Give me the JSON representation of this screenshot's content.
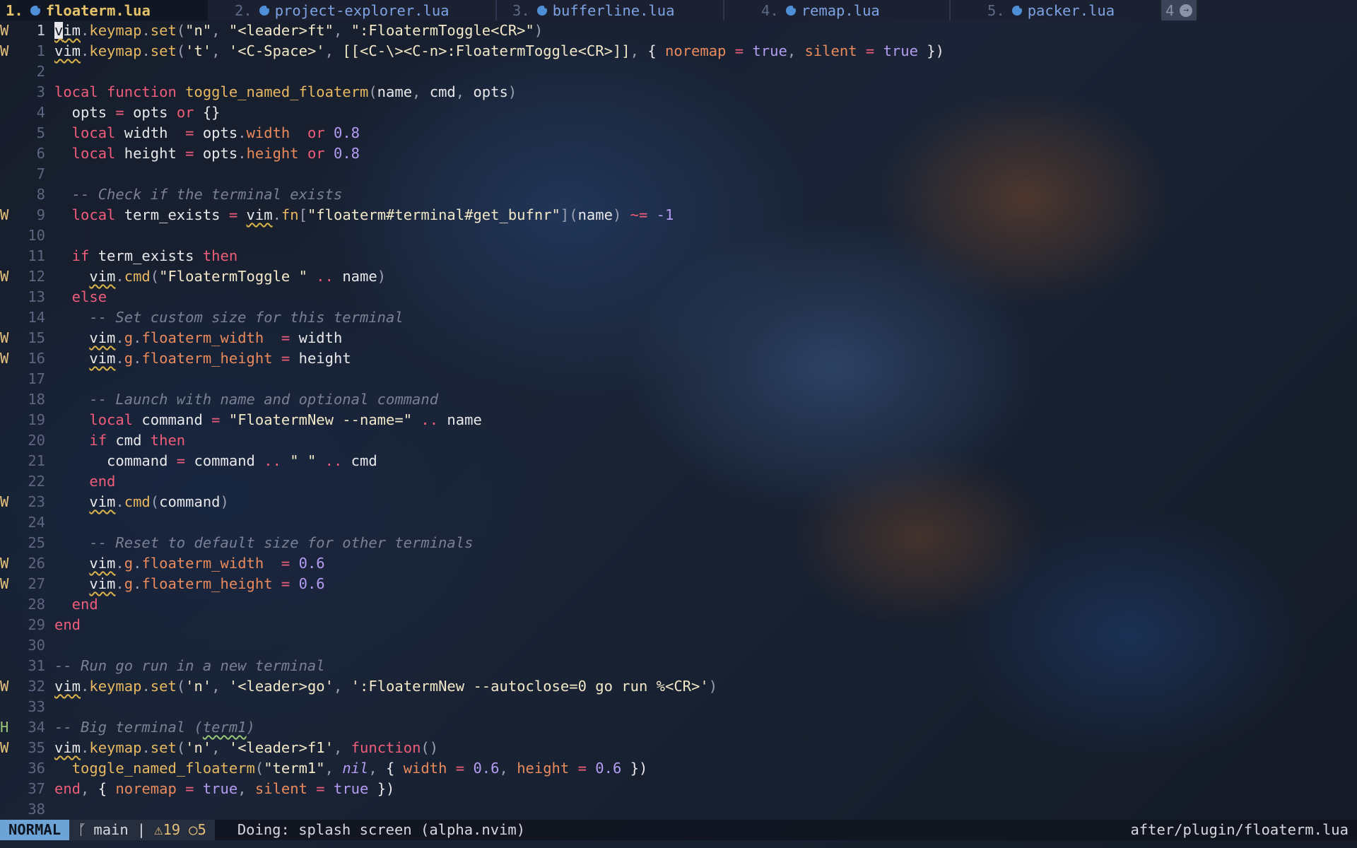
{
  "tabs": [
    {
      "num": "1.",
      "name": "floaterm.lua",
      "active": true
    },
    {
      "num": "2.",
      "name": "project-explorer.lua"
    },
    {
      "num": "3.",
      "name": "bufferline.lua"
    },
    {
      "num": "4.",
      "name": "remap.lua"
    },
    {
      "num": "5.",
      "name": "packer.lua"
    }
  ],
  "tab_overflow": "4",
  "editor": {
    "lines": [
      {
        "sign": "W",
        "nr": "1",
        "cur": true
      },
      {
        "sign": "W",
        "nr": "1"
      },
      {
        "sign": "",
        "nr": "2"
      },
      {
        "sign": "",
        "nr": "3"
      },
      {
        "sign": "",
        "nr": "4"
      },
      {
        "sign": "",
        "nr": "5"
      },
      {
        "sign": "",
        "nr": "6"
      },
      {
        "sign": "",
        "nr": "7"
      },
      {
        "sign": "",
        "nr": "8"
      },
      {
        "sign": "W",
        "nr": "9"
      },
      {
        "sign": "",
        "nr": "10"
      },
      {
        "sign": "",
        "nr": "11"
      },
      {
        "sign": "W",
        "nr": "12"
      },
      {
        "sign": "",
        "nr": "13"
      },
      {
        "sign": "",
        "nr": "14"
      },
      {
        "sign": "W",
        "nr": "15"
      },
      {
        "sign": "W",
        "nr": "16"
      },
      {
        "sign": "",
        "nr": "17"
      },
      {
        "sign": "",
        "nr": "18"
      },
      {
        "sign": "",
        "nr": "19"
      },
      {
        "sign": "",
        "nr": "20"
      },
      {
        "sign": "",
        "nr": "21"
      },
      {
        "sign": "",
        "nr": "22"
      },
      {
        "sign": "W",
        "nr": "23"
      },
      {
        "sign": "",
        "nr": "24"
      },
      {
        "sign": "",
        "nr": "25"
      },
      {
        "sign": "W",
        "nr": "26"
      },
      {
        "sign": "W",
        "nr": "27"
      },
      {
        "sign": "",
        "nr": "28"
      },
      {
        "sign": "",
        "nr": "29"
      },
      {
        "sign": "",
        "nr": "30"
      },
      {
        "sign": "",
        "nr": "31"
      },
      {
        "sign": "W",
        "nr": "32"
      },
      {
        "sign": "",
        "nr": "33"
      },
      {
        "sign": "H",
        "nr": "34"
      },
      {
        "sign": "W",
        "nr": "35"
      },
      {
        "sign": "",
        "nr": "36"
      },
      {
        "sign": "",
        "nr": "37"
      },
      {
        "sign": "",
        "nr": "38"
      }
    ],
    "code": [
      [
        [
          "vim",
          "v",
          1
        ],
        [
          "vim",
          "im"
        ],
        [
          "p",
          "."
        ],
        [
          "fn",
          "keymap"
        ],
        [
          "p",
          "."
        ],
        [
          "fn",
          "set"
        ],
        [
          "p",
          "("
        ],
        [
          "str",
          "\"n\""
        ],
        [
          "p",
          ", "
        ],
        [
          "str",
          "\"<leader>ft\""
        ],
        [
          "p",
          ", "
        ],
        [
          "str",
          "\":FloatermToggle<CR>\""
        ],
        [
          "p",
          ")"
        ]
      ],
      [
        [
          "vim",
          "vim"
        ],
        [
          "p",
          "."
        ],
        [
          "fn",
          "keymap"
        ],
        [
          "p",
          "."
        ],
        [
          "fn",
          "set"
        ],
        [
          "p",
          "("
        ],
        [
          "str",
          "'t'"
        ],
        [
          "p",
          ", "
        ],
        [
          "str",
          "'<C-Space>'"
        ],
        [
          "p",
          ", "
        ],
        [
          "str",
          "[[<C-\\><C-n>:FloatermToggle<CR>]]"
        ],
        [
          "p",
          ", "
        ],
        [
          "var",
          "{ "
        ],
        [
          "prop",
          "noremap"
        ],
        [
          "op",
          " = "
        ],
        [
          "bool",
          "true"
        ],
        [
          "p",
          ", "
        ],
        [
          "prop",
          "silent"
        ],
        [
          "op",
          " = "
        ],
        [
          "bool",
          "true"
        ],
        [
          "var",
          " })"
        ]
      ],
      [],
      [
        [
          "kw",
          "local function "
        ],
        [
          "fn",
          "toggle_named_floaterm"
        ],
        [
          "p",
          "("
        ],
        [
          "var",
          "name"
        ],
        [
          "p",
          ", "
        ],
        [
          "var",
          "cmd"
        ],
        [
          "p",
          ", "
        ],
        [
          "var",
          "opts"
        ],
        [
          "p",
          ")"
        ]
      ],
      [
        [
          "var",
          "  opts "
        ],
        [
          "op",
          "= "
        ],
        [
          "var",
          "opts "
        ],
        [
          "kw",
          "or "
        ],
        [
          "var",
          "{}"
        ]
      ],
      [
        [
          "kw",
          "  local "
        ],
        [
          "var",
          "width  "
        ],
        [
          "op",
          "= "
        ],
        [
          "var",
          "opts"
        ],
        [
          "p",
          "."
        ],
        [
          "prop",
          "width"
        ],
        [
          "var",
          "  "
        ],
        [
          "kw",
          "or "
        ],
        [
          "num",
          "0.8"
        ]
      ],
      [
        [
          "kw",
          "  local "
        ],
        [
          "var",
          "height "
        ],
        [
          "op",
          "= "
        ],
        [
          "var",
          "opts"
        ],
        [
          "p",
          "."
        ],
        [
          "prop",
          "height"
        ],
        [
          "var",
          " "
        ],
        [
          "kw",
          "or "
        ],
        [
          "num",
          "0.8"
        ]
      ],
      [],
      [
        [
          "cmt",
          "  -- Check if the terminal exists"
        ]
      ],
      [
        [
          "kw",
          "  local "
        ],
        [
          "var",
          "term_exists "
        ],
        [
          "op",
          "= "
        ],
        [
          "vim",
          "vim"
        ],
        [
          "p",
          "."
        ],
        [
          "fn",
          "fn"
        ],
        [
          "p",
          "["
        ],
        [
          "str",
          "\"floaterm#terminal#get_bufnr\""
        ],
        [
          "p",
          "]("
        ],
        [
          "var",
          "name"
        ],
        [
          "p",
          ") "
        ],
        [
          "op",
          "~= "
        ],
        [
          "num",
          "-1"
        ]
      ],
      [],
      [
        [
          "kw",
          "  if "
        ],
        [
          "var",
          "term_exists "
        ],
        [
          "kw",
          "then"
        ]
      ],
      [
        [
          "var",
          "    "
        ],
        [
          "vim",
          "vim"
        ],
        [
          "p",
          "."
        ],
        [
          "fn",
          "cmd"
        ],
        [
          "p",
          "("
        ],
        [
          "str",
          "\"FloatermToggle \""
        ],
        [
          "op",
          " .. "
        ],
        [
          "var",
          "name"
        ],
        [
          "p",
          ")"
        ]
      ],
      [
        [
          "kw",
          "  else"
        ]
      ],
      [
        [
          "cmt",
          "    -- Set custom size for this terminal"
        ]
      ],
      [
        [
          "var",
          "    "
        ],
        [
          "vim",
          "vim"
        ],
        [
          "p",
          "."
        ],
        [
          "prop",
          "g"
        ],
        [
          "p",
          "."
        ],
        [
          "prop",
          "floaterm_width"
        ],
        [
          "op",
          "  = "
        ],
        [
          "var",
          "width"
        ]
      ],
      [
        [
          "var",
          "    "
        ],
        [
          "vim",
          "vim"
        ],
        [
          "p",
          "."
        ],
        [
          "prop",
          "g"
        ],
        [
          "p",
          "."
        ],
        [
          "prop",
          "floaterm_height"
        ],
        [
          "op",
          " = "
        ],
        [
          "var",
          "height"
        ]
      ],
      [],
      [
        [
          "cmt",
          "    -- Launch with name and optional command"
        ]
      ],
      [
        [
          "kw",
          "    local "
        ],
        [
          "var",
          "command "
        ],
        [
          "op",
          "= "
        ],
        [
          "str",
          "\"FloatermNew --name=\""
        ],
        [
          "op",
          " .. "
        ],
        [
          "var",
          "name"
        ]
      ],
      [
        [
          "kw",
          "    if "
        ],
        [
          "var",
          "cmd "
        ],
        [
          "kw",
          "then"
        ]
      ],
      [
        [
          "var",
          "      command "
        ],
        [
          "op",
          "= "
        ],
        [
          "var",
          "command "
        ],
        [
          "op",
          ".. "
        ],
        [
          "str",
          "\" \""
        ],
        [
          "op",
          " .. "
        ],
        [
          "var",
          "cmd"
        ]
      ],
      [
        [
          "kw",
          "    end"
        ]
      ],
      [
        [
          "var",
          "    "
        ],
        [
          "vim",
          "vim"
        ],
        [
          "p",
          "."
        ],
        [
          "fn",
          "cmd"
        ],
        [
          "p",
          "("
        ],
        [
          "var",
          "command"
        ],
        [
          "p",
          ")"
        ]
      ],
      [],
      [
        [
          "cmt",
          "    -- Reset to default size for other terminals"
        ]
      ],
      [
        [
          "var",
          "    "
        ],
        [
          "vim",
          "vim"
        ],
        [
          "p",
          "."
        ],
        [
          "prop",
          "g"
        ],
        [
          "p",
          "."
        ],
        [
          "prop",
          "floaterm_width"
        ],
        [
          "op",
          "  = "
        ],
        [
          "num",
          "0.6"
        ]
      ],
      [
        [
          "var",
          "    "
        ],
        [
          "vim",
          "vim"
        ],
        [
          "p",
          "."
        ],
        [
          "prop",
          "g"
        ],
        [
          "p",
          "."
        ],
        [
          "prop",
          "floaterm_height"
        ],
        [
          "op",
          " = "
        ],
        [
          "num",
          "0.6"
        ]
      ],
      [
        [
          "kw",
          "  end"
        ]
      ],
      [
        [
          "kw",
          "end"
        ]
      ],
      [],
      [
        [
          "cmt",
          "-- Run go run in a new terminal"
        ]
      ],
      [
        [
          "vim",
          "vim"
        ],
        [
          "p",
          "."
        ],
        [
          "fn",
          "keymap"
        ],
        [
          "p",
          "."
        ],
        [
          "fn",
          "set"
        ],
        [
          "p",
          "("
        ],
        [
          "str",
          "'n'"
        ],
        [
          "p",
          ", "
        ],
        [
          "str",
          "'<leader>go'"
        ],
        [
          "p",
          ", "
        ],
        [
          "str",
          "':FloatermNew --autoclose=0 go run %<CR>'"
        ],
        [
          "p",
          ")"
        ]
      ],
      [],
      [
        [
          "cmt",
          "-- Big terminal ("
        ],
        [
          "hl",
          "term1"
        ],
        [
          "cmt",
          ")"
        ]
      ],
      [
        [
          "vim",
          "vim"
        ],
        [
          "p",
          "."
        ],
        [
          "fn",
          "keymap"
        ],
        [
          "p",
          "."
        ],
        [
          "fn",
          "set"
        ],
        [
          "p",
          "("
        ],
        [
          "str",
          "'n'"
        ],
        [
          "p",
          ", "
        ],
        [
          "str",
          "'<leader>f1'"
        ],
        [
          "p",
          ", "
        ],
        [
          "kw",
          "function"
        ],
        [
          "p",
          "()"
        ]
      ],
      [
        [
          "var",
          "  "
        ],
        [
          "fn",
          "toggle_named_floaterm"
        ],
        [
          "p",
          "("
        ],
        [
          "str",
          "\"term1\""
        ],
        [
          "p",
          ", "
        ],
        [
          "nil",
          "nil"
        ],
        [
          "p",
          ", "
        ],
        [
          "var",
          "{ "
        ],
        [
          "prop",
          "width"
        ],
        [
          "op",
          " = "
        ],
        [
          "num",
          "0.6"
        ],
        [
          "p",
          ", "
        ],
        [
          "prop",
          "height"
        ],
        [
          "op",
          " = "
        ],
        [
          "num",
          "0.6"
        ],
        [
          "var",
          " })"
        ]
      ],
      [
        [
          "kw",
          "end"
        ],
        [
          "p",
          ", "
        ],
        [
          "var",
          "{ "
        ],
        [
          "prop",
          "noremap"
        ],
        [
          "op",
          " = "
        ],
        [
          "bool",
          "true"
        ],
        [
          "p",
          ", "
        ],
        [
          "prop",
          "silent"
        ],
        [
          "op",
          " = "
        ],
        [
          "bool",
          "true"
        ],
        [
          "var",
          " })"
        ]
      ],
      []
    ]
  },
  "statusline": {
    "mode": "NORMAL",
    "git_icon": "git-branch-icon",
    "branch": "main",
    "separator": "|",
    "warnings": "19",
    "hints": "5",
    "progress": "Doing: splash screen (alpha.nvim)",
    "filepath": "after/plugin/floaterm.lua"
  },
  "colors": {
    "mode_bg": "#6ea3d6",
    "active_tab": "#e6c36b",
    "warning": "#e5c07b"
  }
}
